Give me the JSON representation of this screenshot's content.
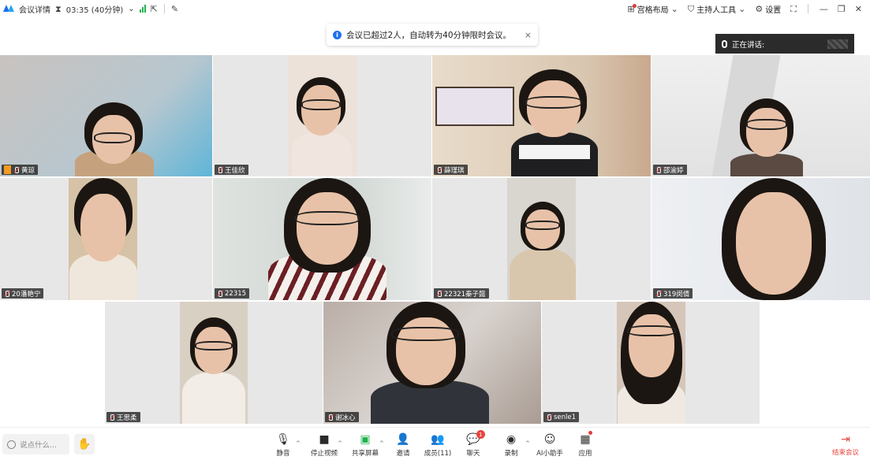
{
  "topbar": {
    "meeting_details": "会议详情",
    "timer": "03:35 (40分钟)",
    "timer_caret": "⌄",
    "grid_layout": "宫格布局",
    "host_tools": "主持人工具",
    "settings": "设置"
  },
  "notice": {
    "message": "会议已超过2人，自动转为40分钟限时会议。",
    "close": "×"
  },
  "speaking": {
    "label": "正在讲话:"
  },
  "tiles": [
    {
      "name": "黄琼"
    },
    {
      "name": "王佳欣"
    },
    {
      "name": "薛瑾琪"
    },
    {
      "name": "邵渝婷"
    },
    {
      "name": "20潘艳宁"
    },
    {
      "name": "22315"
    },
    {
      "name": "22321秦子懿"
    },
    {
      "name": "319闵倩"
    },
    {
      "name": "王思柔"
    },
    {
      "name": "谢冰心"
    },
    {
      "name": "senle1"
    }
  ],
  "bottombar": {
    "chat_placeholder": "说点什么...",
    "mute": "静音",
    "stop_video": "停止视频",
    "share_screen": "共享屏幕",
    "invite": "邀请",
    "members": "成员(11)",
    "chat": "聊天",
    "chat_badge": "1",
    "record": "录制",
    "ai_assistant": "AI小助手",
    "apps": "应用",
    "end_meeting": "结束会议"
  },
  "colors": {
    "accent": "#1f6ff0",
    "end_red": "#e8453c",
    "signal_green": "#22b14c"
  }
}
